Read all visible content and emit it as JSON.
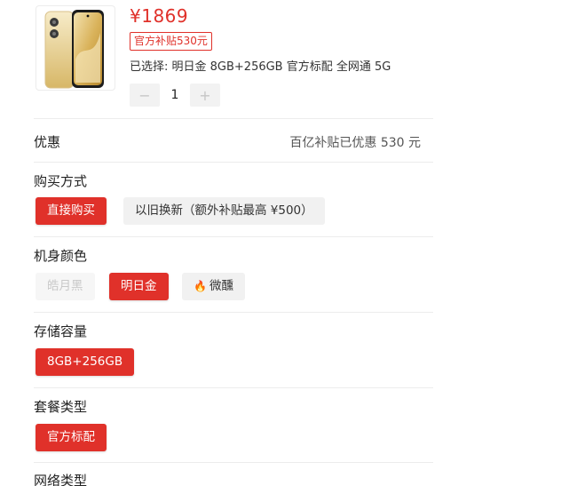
{
  "product": {
    "price": "¥1869",
    "subsidy_badge": "官方补贴530元",
    "selected_summary": "已选择: 明日金 8GB+256GB 官方标配 全网通 5G",
    "quantity": "1",
    "minus": "−",
    "plus": "+"
  },
  "promo": {
    "label": "优惠",
    "value": "百亿补贴已优惠 530 元"
  },
  "purchase_method": {
    "label": "购买方式",
    "options": [
      "直接购买",
      "以旧换新（额外补贴最高 ¥500）"
    ]
  },
  "color": {
    "label": "机身颜色",
    "options": [
      "皓月黑",
      "明日金",
      "微醺"
    ]
  },
  "storage": {
    "label": "存储容量",
    "options": [
      "8GB+256GB"
    ]
  },
  "package": {
    "label": "套餐类型",
    "options": [
      "官方标配"
    ]
  },
  "network": {
    "label": "网络类型"
  },
  "colors": {
    "accent": "#e0312a",
    "option_bg": "#f1f1f1",
    "divider": "#ececec"
  }
}
